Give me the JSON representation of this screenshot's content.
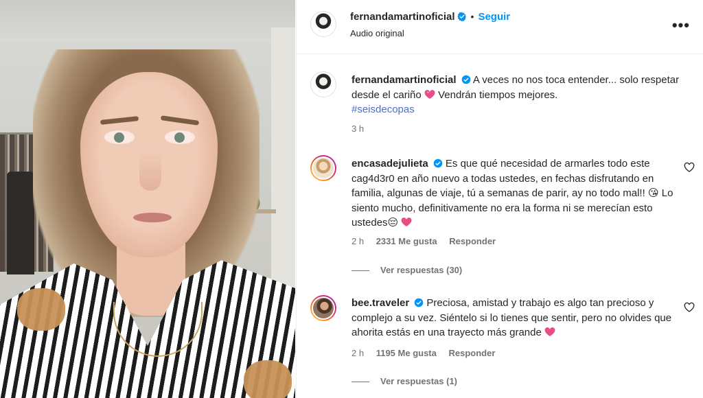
{
  "media": {
    "description_icon": "video-frame"
  },
  "header": {
    "username": "fernandamartinoficial",
    "separator": "•",
    "follow_label": "Seguir",
    "audio_label": "Audio original",
    "more_icon": "more-options-icon"
  },
  "caption": {
    "username": "fernandamartinoficial",
    "text_part1": "A veces no nos toca entender... solo respetar desde el cariño",
    "text_part2": "Vendrán tiempos mejores.",
    "hashtag": "#seisdecopas",
    "time": "3 h"
  },
  "comments": [
    {
      "username": "encasadejulieta",
      "text_part1": "Es que qué necesidad de armarles todo este cag4d3r0 en año nuevo a todas ustedes, en fechas disfrutando en familia, algunas de viaje, tú a semanas de parir, ay no todo mal!!",
      "emoji1": "😘",
      "text_part2": "Lo siento mucho, definitivamente no era la forma ni se merecían esto ustedes",
      "emoji2": "😔",
      "time": "2 h",
      "likes": "2331 Me gusta",
      "reply_label": "Responder",
      "view_replies": "Ver respuestas (30)"
    },
    {
      "username": "bee.traveler",
      "text": "Preciosa, amistad y trabajo es algo tan precioso y complejo a su vez. Siéntelo si lo tienes que sentir, pero no olvides que ahorita estás en una trayecto más grande",
      "time": "2 h",
      "likes": "1195 Me gusta",
      "reply_label": "Responder",
      "view_replies": "Ver respuestas (1)"
    }
  ],
  "colors": {
    "accent_blue": "#0095f6",
    "verified_blue": "#0095f6",
    "heart_pink": "#e84d8a",
    "text_primary": "#262626",
    "text_secondary": "#737373"
  }
}
